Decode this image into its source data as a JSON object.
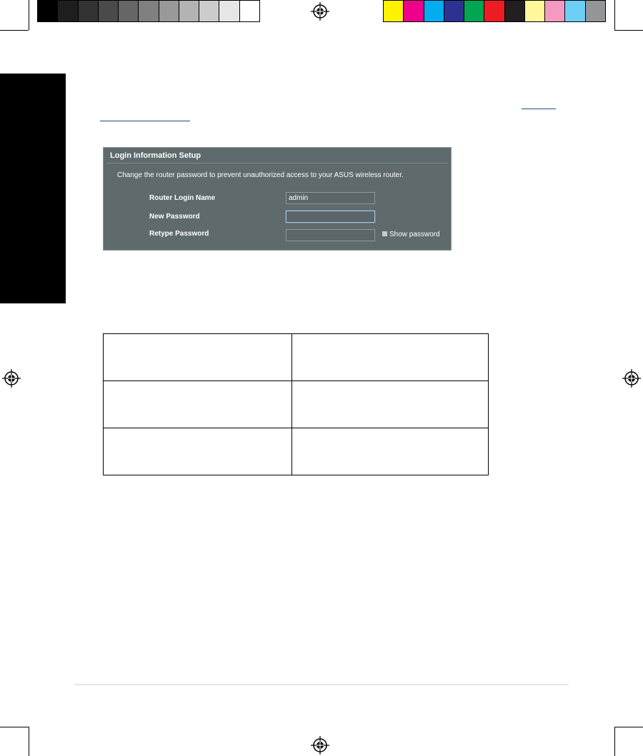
{
  "print_marks": {
    "gray_swatches": [
      "#000000",
      "#1e1e1e",
      "#333333",
      "#4a4a4a",
      "#666666",
      "#808080",
      "#999999",
      "#b3b3b3",
      "#cccccc",
      "#e6e6e6",
      "#ffffff"
    ],
    "color_swatches": [
      "#fff200",
      "#ec008c",
      "#00aeef",
      "#2e3192",
      "#00a651",
      "#ed1c24",
      "#231f20",
      "#fff799",
      "#f49ac2",
      "#6dcff6",
      "#939598"
    ]
  },
  "login_panel": {
    "title": "Login Information Setup",
    "description": "Change the router password to prevent unauthorized access to your ASUS wireless router.",
    "fields": [
      {
        "label": "Router Login Name",
        "value": "admin"
      },
      {
        "label": "New Password",
        "value": ""
      },
      {
        "label": "Retype Password",
        "value": ""
      }
    ],
    "show_password_label": "Show password",
    "show_password_checked": false
  },
  "table": {
    "rows": [
      [
        "",
        ""
      ],
      [
        "",
        ""
      ],
      [
        "",
        ""
      ]
    ]
  }
}
